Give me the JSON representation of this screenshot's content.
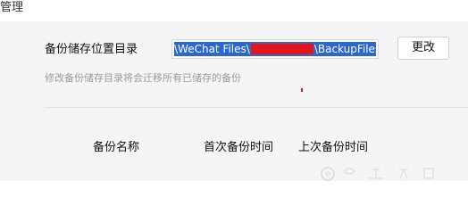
{
  "window": {
    "title": "管理"
  },
  "storage": {
    "label": "备份储存位置目录",
    "path_left": "\\WeChat Files\\",
    "path_right": "\\BackupFiles\\",
    "change_label": "更改",
    "hint": "修改备份储存目录将会迁移所有已储存的备份"
  },
  "table": {
    "columns": [
      "备份名称",
      "首次备份时间",
      "上次备份时间"
    ]
  },
  "colors": {
    "selection": "#2b67d2",
    "redaction": "#e4141b",
    "panel_bg": "#f5f5f5"
  }
}
